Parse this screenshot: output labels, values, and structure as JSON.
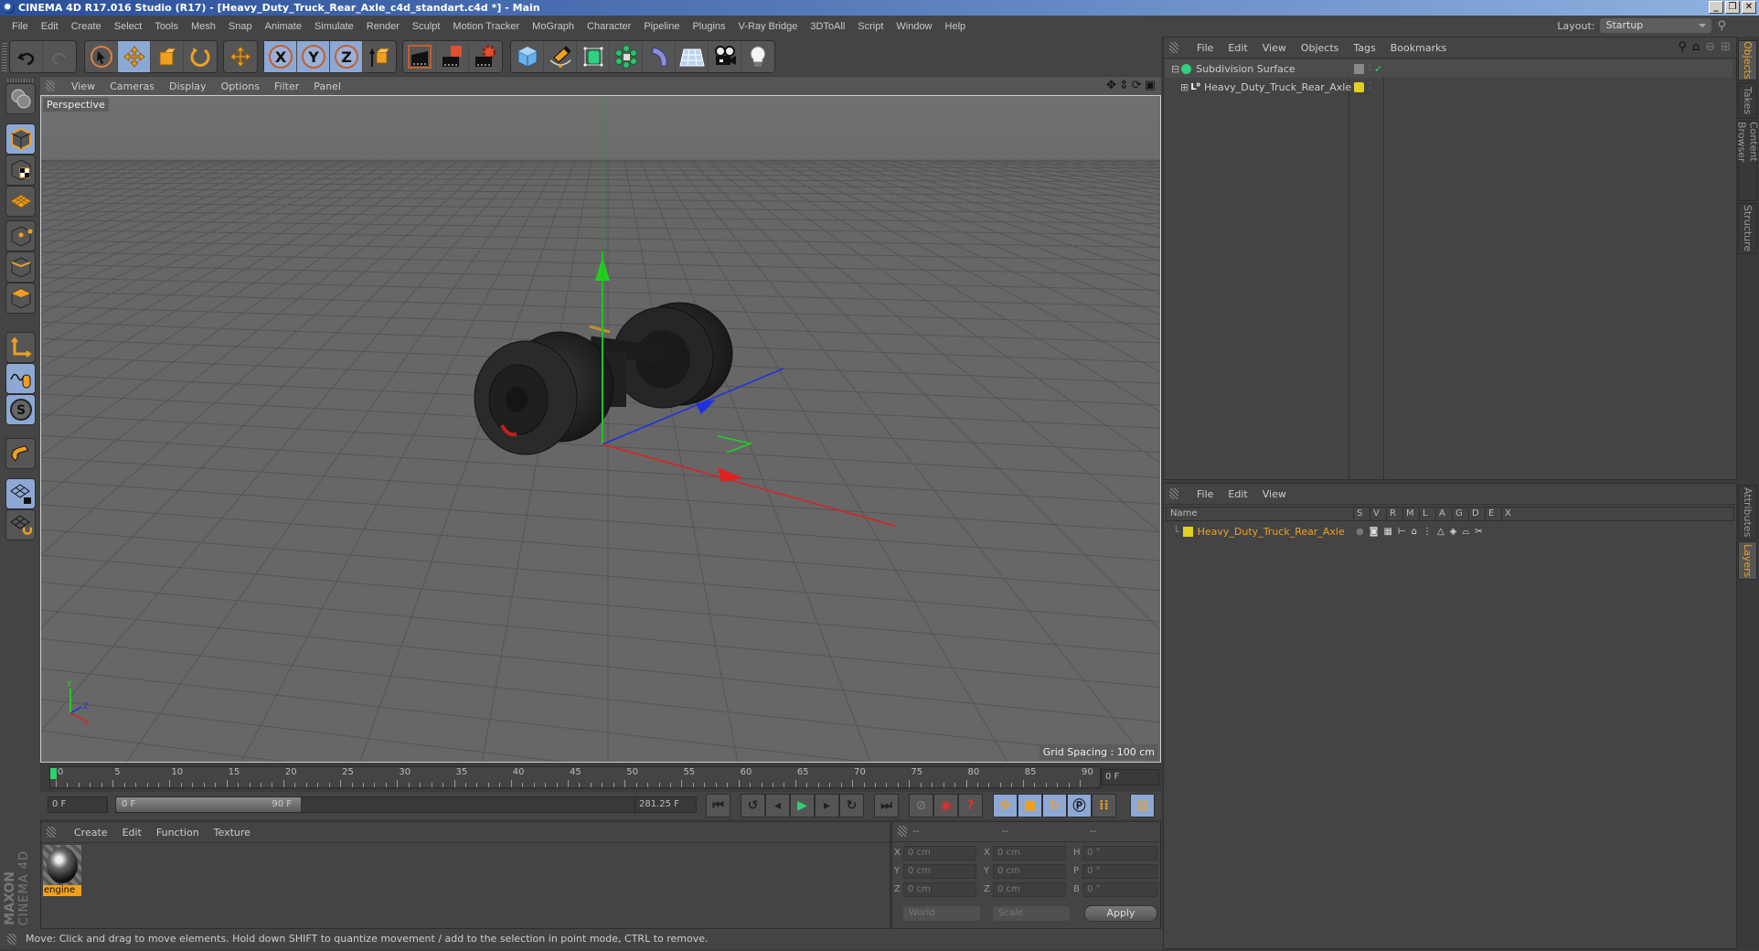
{
  "window": {
    "title": "CINEMA 4D R17.016 Studio (R17) - [Heavy_Duty_Truck_Rear_Axle_c4d_standart.c4d *] - Main",
    "buttons": [
      "_",
      "❐",
      "✕"
    ]
  },
  "menubar": {
    "items": [
      "File",
      "Edit",
      "Create",
      "Select",
      "Tools",
      "Mesh",
      "Snap",
      "Animate",
      "Simulate",
      "Render",
      "Sculpt",
      "Motion Tracker",
      "MoGraph",
      "Character",
      "Pipeline",
      "Plugins",
      "V-Ray Bridge",
      "3DToAll",
      "Script",
      "Window",
      "Help"
    ],
    "layout_label": "Layout:",
    "layout_value": "Startup"
  },
  "toolbar": {
    "groups": [
      [
        "undo-icon",
        "redo-icon"
      ],
      [
        "live-selection-icon",
        "move-icon",
        "scale-icon",
        "rotate-icon"
      ],
      [
        "move-any-icon"
      ],
      [
        "x-axis-lock-icon",
        "y-axis-lock-icon",
        "z-axis-lock-icon",
        "coordinate-system-icon"
      ],
      [
        "render-view-icon",
        "render-picture-viewer-icon",
        "render-settings-icon"
      ],
      [
        "cube-icon",
        "pen-icon",
        "subdivision-icon",
        "cloner-icon",
        "deformer-icon",
        "floor-icon",
        "camera-icon",
        "light-icon"
      ]
    ],
    "axis_labels": [
      "X",
      "Y",
      "Z"
    ]
  },
  "left_toolbar": {
    "items": [
      "workplane-icon",
      "model-mode-icon",
      "texture-mode-icon",
      "workplane-mode-icon",
      "points-mode-icon",
      "edges-mode-icon",
      "polygons-mode-icon",
      "axis-mode-icon",
      "tweak-mode-icon",
      "solo-icon",
      "snap-icon",
      "lock-workplane-icon",
      "workplane-rotate-icon"
    ]
  },
  "viewport": {
    "menu": [
      "View",
      "Cameras",
      "Display",
      "Options",
      "Filter",
      "Panel"
    ],
    "camera_label": "Perspective",
    "grid_spacing": "Grid Spacing : 100 cm",
    "nav_icons": [
      "move-view-icon",
      "zoom-view-icon",
      "rotate-view-icon",
      "maximize-view-icon"
    ],
    "axis_labels": {
      "x": "X",
      "y": "Y",
      "z": "Z"
    },
    "colors": {
      "x": "#e02020",
      "y": "#20d020",
      "z": "#2030e0"
    }
  },
  "timeline": {
    "ticks": [
      "0",
      "5",
      "10",
      "15",
      "20",
      "25",
      "30",
      "35",
      "40",
      "45",
      "50",
      "55",
      "60",
      "65",
      "70",
      "75",
      "80",
      "85",
      "90"
    ],
    "current_frame_field": "0 F",
    "start_field": "0 F",
    "range_start": "0 F",
    "range_end": "90 F",
    "fps_field": "281.25 F",
    "playhead_frame": 0
  },
  "transport": {
    "buttons": [
      "go-to-start-icon",
      "prev-keyframe-icon",
      "prev-frame-icon",
      "play-icon",
      "next-frame-icon",
      "next-keyframe-icon",
      "go-to-end-icon",
      "record-off-icon",
      "autokey-icon",
      "keyframe-selection-icon",
      "move-key-icon",
      "scale-key-icon",
      "rotate-key-icon",
      "param-key-icon",
      "pla-key-icon",
      "timeline-icon"
    ]
  },
  "material_manager": {
    "menu": [
      "Create",
      "Edit",
      "Function",
      "Texture"
    ],
    "materials": [
      {
        "name": "engine"
      }
    ]
  },
  "coordinates": {
    "headers": [
      "--",
      "--",
      "--"
    ],
    "rows": [
      {
        "l1": "X",
        "v1": "0 cm",
        "l2": "X",
        "v2": "0 cm",
        "l3": "H",
        "v3": "0 °"
      },
      {
        "l1": "Y",
        "v1": "0 cm",
        "l2": "Y",
        "v2": "0 cm",
        "l3": "P",
        "v3": "0 °"
      },
      {
        "l1": "Z",
        "v1": "0 cm",
        "l2": "Z",
        "v2": "0 cm",
        "l3": "B",
        "v3": "0 °"
      }
    ],
    "space": "World",
    "mode": "Scale",
    "apply": "Apply"
  },
  "object_manager": {
    "menu": [
      "File",
      "Edit",
      "View",
      "Objects",
      "Tags",
      "Bookmarks"
    ],
    "objects": [
      {
        "name": "Subdivision Surface",
        "expanded": true,
        "indent": 0,
        "tag": "subdivision",
        "enabled": true
      },
      {
        "name": "Heavy_Duty_Truck_Rear_Axle",
        "expanded": false,
        "indent": 1,
        "tag": "null",
        "layer_color": "#e0d020"
      }
    ]
  },
  "layer_manager": {
    "menu": [
      "File",
      "Edit",
      "View"
    ],
    "columns": [
      "Name",
      "S",
      "V",
      "R",
      "M",
      "L",
      "A",
      "G",
      "D",
      "E",
      "X"
    ],
    "layers": [
      {
        "name": "Heavy_Duty_Truck_Rear_Axle",
        "color": "#e0d020",
        "text_color": "#f0a020"
      }
    ]
  },
  "right_tabs": {
    "top": [
      {
        "label": "Objects",
        "active": true
      },
      {
        "label": "Takes",
        "active": false
      },
      {
        "label": "Content Browser",
        "active": false
      },
      {
        "label": "Structure",
        "active": false
      }
    ],
    "bottom": [
      {
        "label": "Attributes",
        "active": false
      },
      {
        "label": "Layers",
        "active": true
      }
    ]
  },
  "branding": {
    "line1": "MAXON",
    "line2": "CINEMA 4D"
  },
  "statusbar": {
    "text": "Move: Click and drag to move elements. Hold down SHIFT to quantize movement / add to the selection in point mode, CTRL to remove."
  }
}
